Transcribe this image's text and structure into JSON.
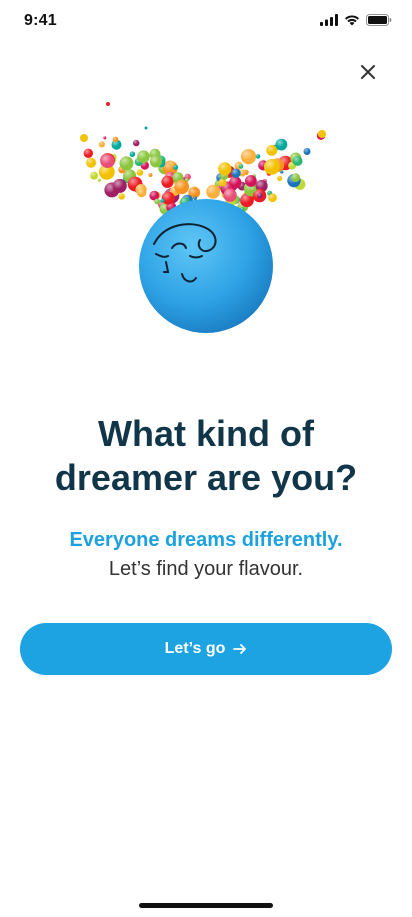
{
  "status_bar": {
    "time": "9:41",
    "icons": [
      "cellular-signal-icon",
      "wifi-icon",
      "battery-icon"
    ]
  },
  "header": {
    "close_icon": "close-icon"
  },
  "hero": {
    "image": "blue-dreamer-face-with-colorful-bubbles"
  },
  "content": {
    "headline_line1": "What kind of",
    "headline_line2": "dreamer are you?",
    "subhead": "Everyone dreams differently.",
    "subtext": "Let’s find your flavour."
  },
  "cta": {
    "label": "Let’s go",
    "icon": "arrow-right-icon"
  },
  "colors": {
    "accent": "#1da3e2",
    "headline": "#113649",
    "subhead": "#1da1e0"
  }
}
